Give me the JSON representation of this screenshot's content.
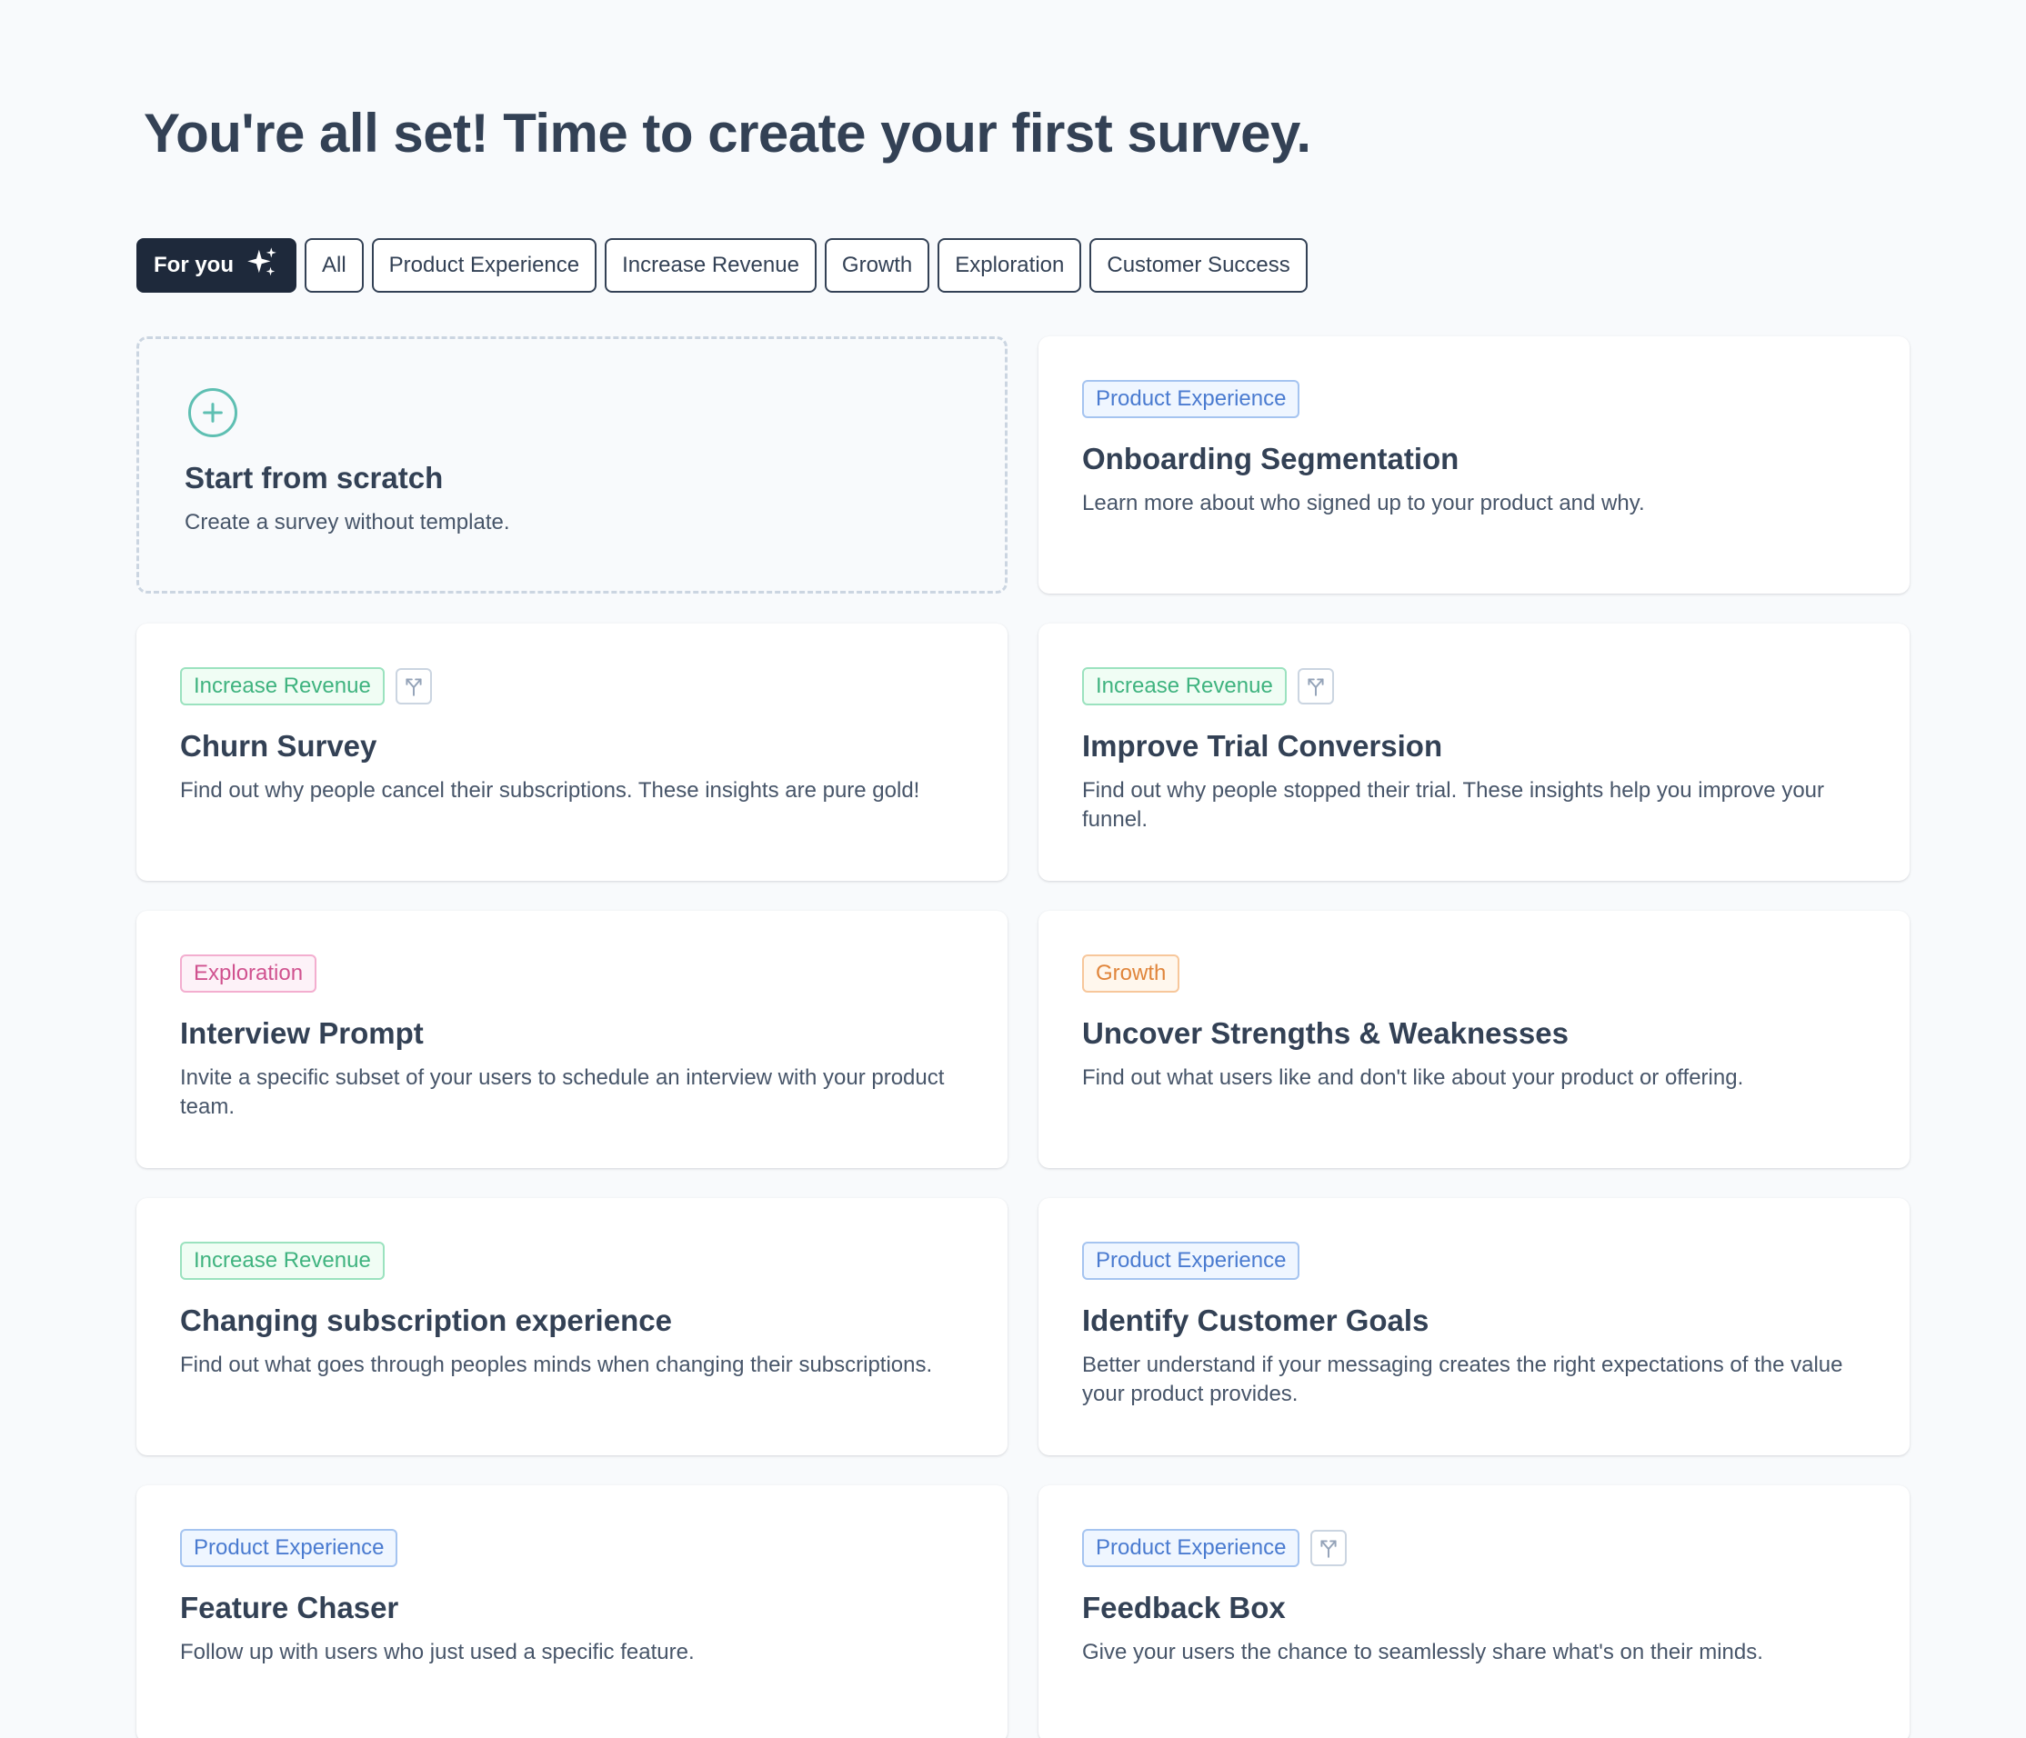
{
  "page": {
    "title": "You're all set! Time to create your first survey."
  },
  "filters": [
    {
      "label": "For you",
      "icon": "sparkles-icon",
      "active": true
    },
    {
      "label": "All"
    },
    {
      "label": "Product Experience"
    },
    {
      "label": "Increase Revenue"
    },
    {
      "label": "Growth"
    },
    {
      "label": "Exploration"
    },
    {
      "label": "Customer Success"
    }
  ],
  "scratch": {
    "icon": "plus-circle-icon",
    "title": "Start from scratch",
    "description": "Create a survey without template."
  },
  "templates": [
    {
      "tag": "Product Experience",
      "tag_type": "product",
      "branching": false,
      "title": "Onboarding Segmentation",
      "description": "Learn more about who signed up to your product and why."
    },
    {
      "tag": "Increase Revenue",
      "tag_type": "revenue",
      "branching": true,
      "title": "Churn Survey",
      "description": "Find out why people cancel their subscriptions. These insights are pure gold!"
    },
    {
      "tag": "Increase Revenue",
      "tag_type": "revenue",
      "branching": true,
      "title": "Improve Trial Conversion",
      "description": "Find out why people stopped their trial. These insights help you improve your funnel."
    },
    {
      "tag": "Exploration",
      "tag_type": "exploration",
      "branching": false,
      "title": "Interview Prompt",
      "description": "Invite a specific subset of your users to schedule an interview with your product team."
    },
    {
      "tag": "Growth",
      "tag_type": "growth",
      "branching": false,
      "title": "Uncover Strengths & Weaknesses",
      "description": "Find out what users like and don't like about your product or offering."
    },
    {
      "tag": "Increase Revenue",
      "tag_type": "revenue",
      "branching": false,
      "title": "Changing subscription experience",
      "description": "Find out what goes through peoples minds when changing their subscriptions."
    },
    {
      "tag": "Product Experience",
      "tag_type": "product",
      "branching": false,
      "title": "Identify Customer Goals",
      "description": "Better understand if your messaging creates the right expectations of the value your product provides."
    },
    {
      "tag": "Product Experience",
      "tag_type": "product",
      "branching": false,
      "title": "Feature Chaser",
      "description": "Follow up with users who just used a specific feature."
    },
    {
      "tag": "Product Experience",
      "tag_type": "product",
      "branching": true,
      "title": "Feedback Box",
      "description": "Give your users the chance to seamlessly share what's on their minds."
    }
  ],
  "colors": {
    "background": "#f8fafc",
    "heading": "#334155",
    "active_filter": "#1e293b",
    "scratch_accent": "#5ebfb2",
    "tag_product": "#4a7bd0",
    "tag_revenue": "#3fb37f",
    "tag_exploration": "#d0528f",
    "tag_growth": "#e0853b"
  }
}
